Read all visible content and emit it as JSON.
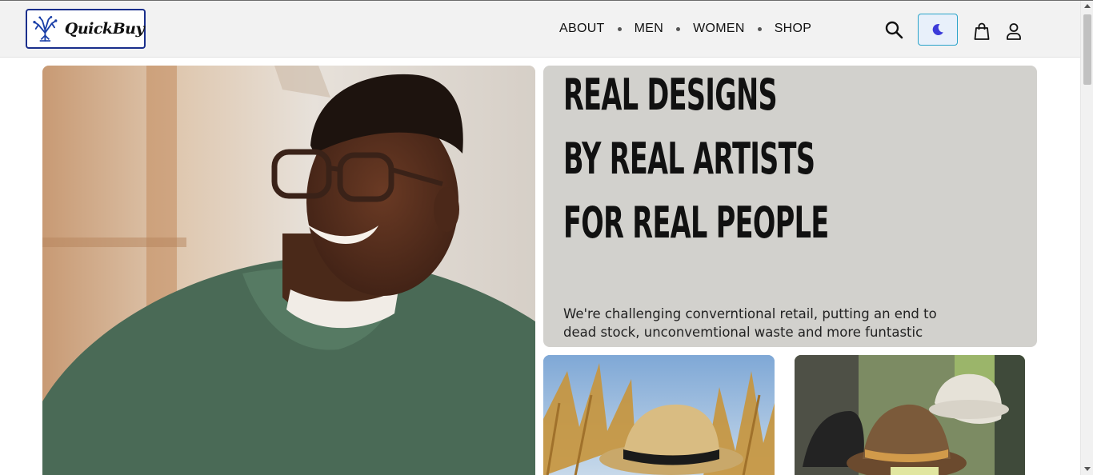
{
  "brand": {
    "name": "QuickBuy"
  },
  "nav": {
    "items": [
      {
        "label": "ABOUT"
      },
      {
        "label": "MEN"
      },
      {
        "label": "WOMEN"
      },
      {
        "label": "SHOP"
      }
    ]
  },
  "header_icons": {
    "search": "search-icon",
    "theme": "moon-icon",
    "cart": "shopping-bag-icon",
    "account": "user-icon",
    "theme_accent": "#3b3bd9"
  },
  "hero": {
    "image": "man-smiling-glasses-green-sweater"
  },
  "banner": {
    "line1": "REAL DESIGNS",
    "line2": "BY REAL ARTISTS",
    "line3": "FOR REAL PEOPLE",
    "text_line1": "We're challenging converntional retail, putting an end to",
    "text_line2": "dead stock, unconvemtional waste and more funtastic"
  },
  "tiles": [
    {
      "image": "straw-hat-in-wheat-field"
    },
    {
      "image": "hats-display"
    }
  ]
}
